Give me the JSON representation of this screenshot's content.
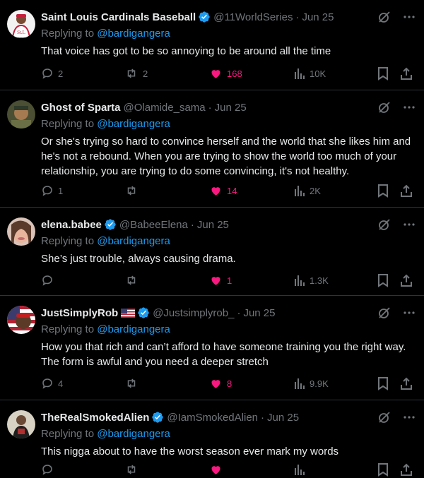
{
  "colors": {
    "background": "#000000",
    "text": "#e7e9ea",
    "muted": "#71767b",
    "accent": "#1d9bf0",
    "like": "#f91880",
    "border": "#2f3336"
  },
  "replying_prefix": "Replying to",
  "tweets": [
    {
      "name": "Saint Louis Cardinals Baseball",
      "verified": true,
      "flag": "",
      "handle": "@11WorldSeries",
      "date": "Jun 25",
      "reply_to": "@bardigangera",
      "text": "That voice has got to be so annoying to be around all the time",
      "replies": "2",
      "retweets": "2",
      "likes": "168",
      "views": "10K",
      "liked": true
    },
    {
      "name": "Ghost of Sparta",
      "verified": false,
      "flag": "",
      "handle": "@Olamide_sama",
      "date": "Jun 25",
      "reply_to": "@bardigangera",
      "text": "Or she's trying so hard to convince herself and the world that she likes him and he's not a rebound. When you are trying to show the world too much of your relationship, you are trying to do some convincing, it's not healthy.",
      "replies": "1",
      "retweets": "",
      "likes": "14",
      "views": "2K",
      "liked": true
    },
    {
      "name": "elena.babee",
      "verified": true,
      "flag": "",
      "handle": "@BabeeElena",
      "date": "Jun 25",
      "reply_to": "@bardigangera",
      "text": "She’s just trouble, always causing drama.",
      "replies": "",
      "retweets": "",
      "likes": "1",
      "views": "1.3K",
      "liked": true
    },
    {
      "name": "JustSimplyRob",
      "verified": true,
      "flag": "us-flag",
      "handle": "@Justsimplyrob_",
      "date": "Jun 25",
      "reply_to": "@bardigangera",
      "text": "How you that rich and can’t afford to have someone training you the right way. The form is awful and you need a deeper stretch",
      "replies": "4",
      "retweets": "",
      "likes": "8",
      "views": "9.9K",
      "liked": true
    },
    {
      "name": "TheRealSmokedAlien",
      "verified": true,
      "flag": "",
      "handle": "@IamSmokedAlien",
      "date": "Jun 25",
      "reply_to": "@bardigangera",
      "text": "This nigga about to have the worst season ever mark my words",
      "replies": "",
      "retweets": "",
      "likes": "",
      "views": "",
      "liked": true
    }
  ],
  "icons": {
    "reply": "reply-icon",
    "retweet": "retweet-icon",
    "like": "heart-icon",
    "views": "views-icon",
    "bookmark": "bookmark-icon",
    "share": "share-icon",
    "grok": "grok-icon",
    "more": "more-icon",
    "verified": "verified-badge-icon"
  }
}
